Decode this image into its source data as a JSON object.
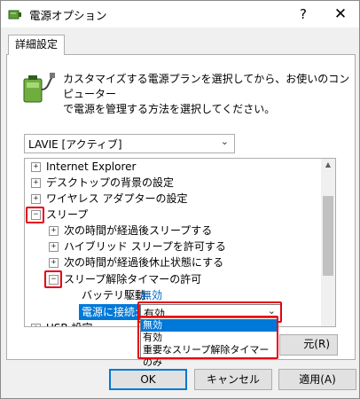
{
  "window": {
    "title": "電源オプション",
    "help_symbol": "?",
    "close_symbol": "✕"
  },
  "tab": {
    "label": "詳細設定"
  },
  "description": {
    "line1": "カスタマイズする電源プランを選択してから、お使いのコンピューター",
    "line2": "で電源を管理する方法を選択してください。"
  },
  "plan_select": {
    "value": "LAVIE [アクティブ]"
  },
  "tree": {
    "items": [
      {
        "label": "Internet Explorer",
        "state": "+"
      },
      {
        "label": "デスクトップの背景の設定",
        "state": "+"
      },
      {
        "label": "ワイヤレス アダプターの設定",
        "state": "+"
      },
      {
        "label": "スリープ",
        "state": "−"
      },
      {
        "label": "次の時間が経過後スリープする",
        "state": "+"
      },
      {
        "label": "ハイブリッド スリープを許可する",
        "state": "+"
      },
      {
        "label": "次の時間が経過後休止状態にする",
        "state": "+"
      },
      {
        "label": "スリープ解除タイマーの許可",
        "state": "−"
      },
      {
        "label": "バッテリ駆動:",
        "value": "無効"
      },
      {
        "label": "電源に接続:",
        "value": "有効"
      },
      {
        "label": "USB 設定",
        "state": "+"
      }
    ]
  },
  "dropdown": {
    "options": [
      "無効",
      "有効",
      "重要なスリープ解除タイマーのみ"
    ],
    "selected_index": 0
  },
  "buttons": {
    "restore": "元(R)",
    "ok": "OK",
    "cancel": "キャンセル",
    "apply": "適用(A)"
  },
  "colors": {
    "highlight": "#0078d7",
    "callout_red": "#e60012",
    "link_blue": "#0066cc"
  }
}
